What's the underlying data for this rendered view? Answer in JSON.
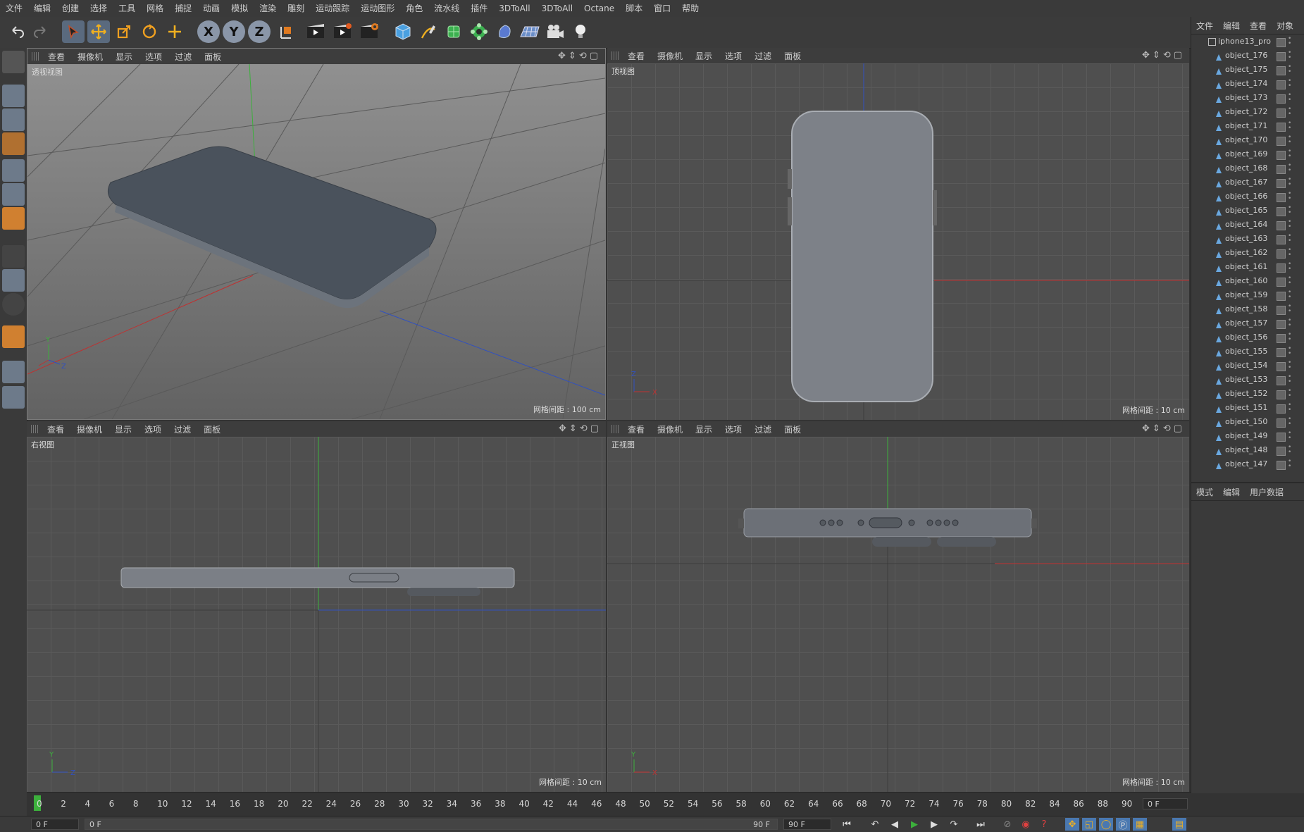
{
  "menu": [
    "文件",
    "编辑",
    "创建",
    "选择",
    "工具",
    "网格",
    "捕捉",
    "动画",
    "模拟",
    "渲染",
    "雕刻",
    "运动跟踪",
    "运动图形",
    "角色",
    "流水线",
    "插件",
    "3DToAll",
    "3DToAll",
    "Octane",
    "脚本",
    "窗口",
    "帮助"
  ],
  "toolbar": {
    "axis_x": "X",
    "axis_y": "Y",
    "axis_z": "Z"
  },
  "viewport_menu": [
    "查看",
    "摄像机",
    "显示",
    "选项",
    "过滤",
    "面板"
  ],
  "viewports": {
    "perspective": {
      "label": "透视视图",
      "grid": "网格间距 : 100 cm"
    },
    "top": {
      "label": "顶视图",
      "grid": "网格间距 : 10 cm"
    },
    "right": {
      "label": "右视图",
      "grid": "网格间距 : 10 cm"
    },
    "front": {
      "label": "正视图",
      "grid": "网格间距 : 10 cm"
    }
  },
  "object_panel": {
    "tabs": [
      "文件",
      "编辑",
      "查看",
      "对象"
    ],
    "root": "iphone13_pro",
    "items": [
      "object_176",
      "object_175",
      "object_174",
      "object_173",
      "object_172",
      "object_171",
      "object_170",
      "object_169",
      "object_168",
      "object_167",
      "object_166",
      "object_165",
      "object_164",
      "object_163",
      "object_162",
      "object_161",
      "object_160",
      "object_159",
      "object_158",
      "object_157",
      "object_156",
      "object_155",
      "object_154",
      "object_153",
      "object_152",
      "object_151",
      "object_150",
      "object_149",
      "object_148",
      "object_147"
    ]
  },
  "attr_panel": {
    "tabs": [
      "模式",
      "编辑",
      "用户数据"
    ]
  },
  "timeline": {
    "ticks": [
      "0",
      "2",
      "4",
      "6",
      "8",
      "10",
      "12",
      "14",
      "16",
      "18",
      "20",
      "22",
      "24",
      "26",
      "28",
      "30",
      "32",
      "34",
      "36",
      "38",
      "40",
      "42",
      "44",
      "46",
      "48",
      "50",
      "52",
      "54",
      "56",
      "58",
      "60",
      "62",
      "64",
      "66",
      "68",
      "70",
      "72",
      "74",
      "76",
      "78",
      "80",
      "82",
      "84",
      "86",
      "88",
      "90"
    ],
    "current_frame": "0 F"
  },
  "playbar": {
    "start": "0 F",
    "range_start": "0 F",
    "range_end": "90 F",
    "end": "90 F"
  },
  "colors": {
    "x_axis": "#c03030",
    "y_axis": "#3cb03c",
    "z_axis": "#3050c0",
    "accent": "#5a6a7e"
  }
}
